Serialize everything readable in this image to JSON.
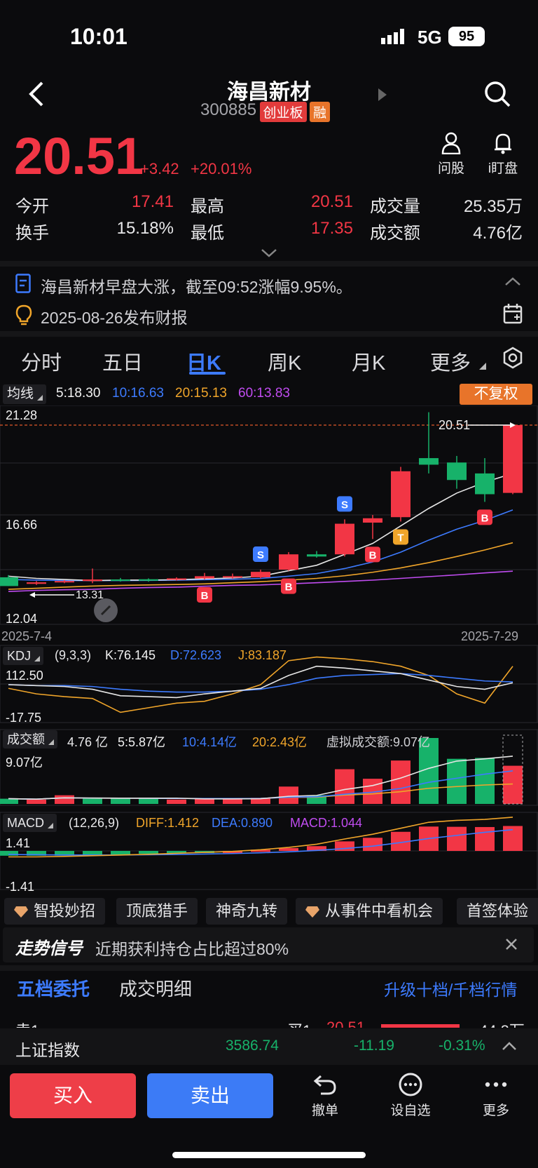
{
  "status_bar": {
    "time": "10:01",
    "network": "5G",
    "battery": "95"
  },
  "header": {
    "title": "海昌新材",
    "code": "300885",
    "board_tag": "创业板",
    "margin_tag": "融"
  },
  "quote": {
    "price": "20.51",
    "change": "+3.42",
    "change_pct": "+20.01%",
    "ask_label": "问股",
    "watch_label": "i盯盘",
    "rows": [
      [
        {
          "label": "今开",
          "value": "17.41"
        },
        {
          "label": "最高",
          "value": "20.51"
        },
        {
          "label": "成交量",
          "value": "25.35万"
        }
      ],
      [
        {
          "label": "换手",
          "value": "15.18%"
        },
        {
          "label": "最低",
          "value": "17.35"
        },
        {
          "label": "成交额",
          "value": "4.76亿"
        }
      ]
    ]
  },
  "news": {
    "headline": "海昌新材早盘大涨，截至09:52涨幅9.95%。",
    "report": "2025-08-26发布财报"
  },
  "tabs": [
    "分时",
    "五日",
    "日K",
    "周K",
    "月K",
    "更多"
  ],
  "active_tab": 2,
  "ma_bar": {
    "label": "均线",
    "ma5": "5:18.30",
    "ma10": "10:16.63",
    "ma20": "20:15.13",
    "ma60": "60:13.83",
    "adjust": "不复权"
  },
  "kline": {
    "y_top": "21.28",
    "y_mid": "16.66",
    "y_bottom": "12.04",
    "price_label": "20.51",
    "low_label": "13.31",
    "date_start": "2025-7-4",
    "date_end": "2025-7-29"
  },
  "kdj": {
    "label": "KDJ",
    "params": "(9,3,3)",
    "k": "K:76.145",
    "d": "D:72.623",
    "j": "J:83.187",
    "y_top": "112.50",
    "y_bottom": "-17.75"
  },
  "volume": {
    "label": "成交额",
    "value": "4.76 亿",
    "ma5": "5:5.87亿",
    "ma10": "10:4.14亿",
    "ma20": "20:2.43亿",
    "virtual": "虚拟成交额:9.07亿",
    "y_top": "9.07亿"
  },
  "macd": {
    "label": "MACD",
    "params": "(12,26,9)",
    "diff": "DIFF:1.412",
    "dea": "DEA:0.890",
    "macd": "MACD:1.044",
    "y_top": "1.41",
    "y_bottom": "-1.41"
  },
  "chips": [
    "智投妙招",
    "顶底猎手",
    "神奇九转",
    "从事件中看机会",
    "首签体验"
  ],
  "signal": {
    "title": "走势信号",
    "text": "近期获利持仓占比超过80%"
  },
  "order_tabs": {
    "five": "五档委托",
    "detail": "成交明细",
    "upgrade": "升级十档/千档行情"
  },
  "order_row": {
    "sell_label": "卖1",
    "sell_price": "--",
    "sell_vol": "--",
    "buy_label": "买1",
    "buy_price": "20.51",
    "buy_vol": "44.8万"
  },
  "index_bar": {
    "name": "上证指数",
    "value": "3586.74",
    "change": "-11.19",
    "pct": "-0.31%"
  },
  "actions": {
    "buy": "买入",
    "sell": "卖出",
    "cancel": "撤单",
    "watchlist": "设自选",
    "more": "更多"
  },
  "colors": {
    "up": "#f23645",
    "down": "#17b26a",
    "ma5": "#e6e6e6",
    "ma10": "#3d7bff",
    "ma20": "#f0a52a",
    "ma60": "#c04cf0"
  },
  "chart_data": {
    "type": "candlestick",
    "x_range": [
      "2025-7-4",
      "2025-7-29"
    ],
    "ylim": [
      12.04,
      21.28
    ],
    "candles": [
      {
        "o": 13.55,
        "h": 13.65,
        "l": 13.15,
        "c": 13.15,
        "dir": "down"
      },
      {
        "o": 13.25,
        "h": 13.38,
        "l": 13.2,
        "c": 13.32,
        "dir": "up"
      },
      {
        "o": 13.32,
        "h": 13.42,
        "l": 13.28,
        "c": 13.38,
        "dir": "up"
      },
      {
        "o": 13.38,
        "h": 13.95,
        "l": 13.28,
        "c": 13.45,
        "dir": "up"
      },
      {
        "o": 13.45,
        "h": 13.52,
        "l": 13.35,
        "c": 13.4,
        "dir": "down"
      },
      {
        "o": 13.42,
        "h": 13.5,
        "l": 13.35,
        "c": 13.46,
        "dir": "down"
      },
      {
        "o": 13.46,
        "h": 13.55,
        "l": 13.4,
        "c": 13.5,
        "dir": "up"
      },
      {
        "o": 13.5,
        "h": 13.75,
        "l": 13.45,
        "c": 13.6,
        "dir": "up"
      },
      {
        "o": 13.6,
        "h": 13.72,
        "l": 13.48,
        "c": 13.55,
        "dir": "up"
      },
      {
        "o": 13.55,
        "h": 13.9,
        "l": 13.5,
        "c": 13.8,
        "dir": "up"
      },
      {
        "o": 13.9,
        "h": 14.7,
        "l": 13.85,
        "c": 14.6,
        "dir": "up"
      },
      {
        "o": 14.6,
        "h": 14.75,
        "l": 14.45,
        "c": 14.5,
        "dir": "down"
      },
      {
        "o": 14.6,
        "h": 16.2,
        "l": 14.5,
        "c": 16.0,
        "dir": "up"
      },
      {
        "o": 16.05,
        "h": 16.4,
        "l": 15.3,
        "c": 16.25,
        "dir": "up"
      },
      {
        "o": 16.3,
        "h": 18.6,
        "l": 16.1,
        "c": 18.4,
        "dir": "up"
      },
      {
        "o": 19.0,
        "h": 21.1,
        "l": 18.3,
        "c": 18.7,
        "dir": "down"
      },
      {
        "o": 18.8,
        "h": 19.1,
        "l": 17.6,
        "c": 18.0,
        "dir": "down"
      },
      {
        "o": 18.3,
        "h": 19.0,
        "l": 17.0,
        "c": 17.35,
        "dir": "down"
      },
      {
        "o": 17.41,
        "h": 20.51,
        "l": 17.35,
        "c": 20.51,
        "dir": "up"
      }
    ],
    "signals": [
      {
        "i": 7,
        "type": "B"
      },
      {
        "i": 9,
        "type": "S"
      },
      {
        "i": 10,
        "type": "B"
      },
      {
        "i": 12,
        "type": "S"
      },
      {
        "i": 13,
        "type": "B"
      },
      {
        "i": 14,
        "type": "T"
      },
      {
        "i": 15,
        "type": "S"
      },
      {
        "i": 17,
        "type": "B"
      }
    ],
    "ma5": [
      13.6,
      13.5,
      13.45,
      13.4,
      13.42,
      13.42,
      13.44,
      13.48,
      13.52,
      13.6,
      13.85,
      14.1,
      14.6,
      15.1,
      15.9,
      16.7,
      17.4,
      17.9,
      18.3
    ],
    "ma10": [
      13.45,
      13.42,
      13.4,
      13.4,
      13.4,
      13.41,
      13.42,
      13.44,
      13.46,
      13.5,
      13.6,
      13.72,
      13.95,
      14.25,
      14.7,
      15.25,
      15.75,
      16.15,
      16.63
    ],
    "ma20": [
      13.0,
      13.05,
      13.1,
      13.15,
      13.18,
      13.2,
      13.22,
      13.25,
      13.3,
      13.35,
      13.42,
      13.5,
      13.62,
      13.78,
      13.98,
      14.22,
      14.5,
      14.8,
      15.13
    ],
    "ma60": [
      12.9,
      12.95,
      12.98,
      13.0,
      13.05,
      13.08,
      13.1,
      13.14,
      13.18,
      13.2,
      13.25,
      13.3,
      13.36,
      13.42,
      13.5,
      13.58,
      13.66,
      13.75,
      13.83
    ],
    "volume": [
      0.3,
      0.25,
      0.5,
      0.3,
      0.3,
      0.3,
      0.25,
      0.3,
      0.3,
      0.35,
      1.0,
      0.5,
      2.0,
      1.45,
      2.5,
      3.8,
      2.6,
      2.65,
      2.2
    ],
    "volume_dir": [
      "down",
      "up",
      "up",
      "down",
      "down",
      "down",
      "up",
      "up",
      "up",
      "up",
      "up",
      "down",
      "up",
      "up",
      "up",
      "down",
      "down",
      "down",
      "up"
    ],
    "kdj_k": [
      10,
      9,
      8,
      5,
      -2,
      -3,
      -4,
      0,
      3,
      6,
      20,
      30,
      28,
      25,
      22,
      15,
      8,
      5,
      12
    ],
    "kdj_d": [
      10,
      9,
      9,
      8,
      5,
      3,
      2,
      2,
      3,
      5,
      10,
      17,
      20,
      21,
      22,
      20,
      17,
      14,
      13
    ],
    "kdj_j": [
      6,
      0,
      -3,
      -5,
      -20,
      -15,
      -10,
      -8,
      0,
      10,
      36,
      40,
      38,
      35,
      30,
      20,
      0,
      -10,
      30
    ],
    "macd_hist": [
      -0.2,
      -0.2,
      -0.2,
      -0.18,
      -0.15,
      -0.12,
      -0.1,
      -0.05,
      0.0,
      0.05,
      0.12,
      0.2,
      0.4,
      0.55,
      0.8,
      1.02,
      1.01,
      1.0,
      1.044
    ],
    "macd_diff": [
      -0.25,
      -0.25,
      -0.23,
      -0.2,
      -0.17,
      -0.14,
      -0.1,
      -0.06,
      -0.02,
      0.05,
      0.15,
      0.28,
      0.5,
      0.7,
      0.95,
      1.2,
      1.28,
      1.32,
      1.412
    ],
    "macd_dea": [
      -0.15,
      -0.16,
      -0.17,
      -0.17,
      -0.17,
      -0.16,
      -0.15,
      -0.13,
      -0.11,
      -0.08,
      -0.04,
      0.02,
      0.1,
      0.2,
      0.35,
      0.52,
      0.65,
      0.78,
      0.89
    ]
  }
}
